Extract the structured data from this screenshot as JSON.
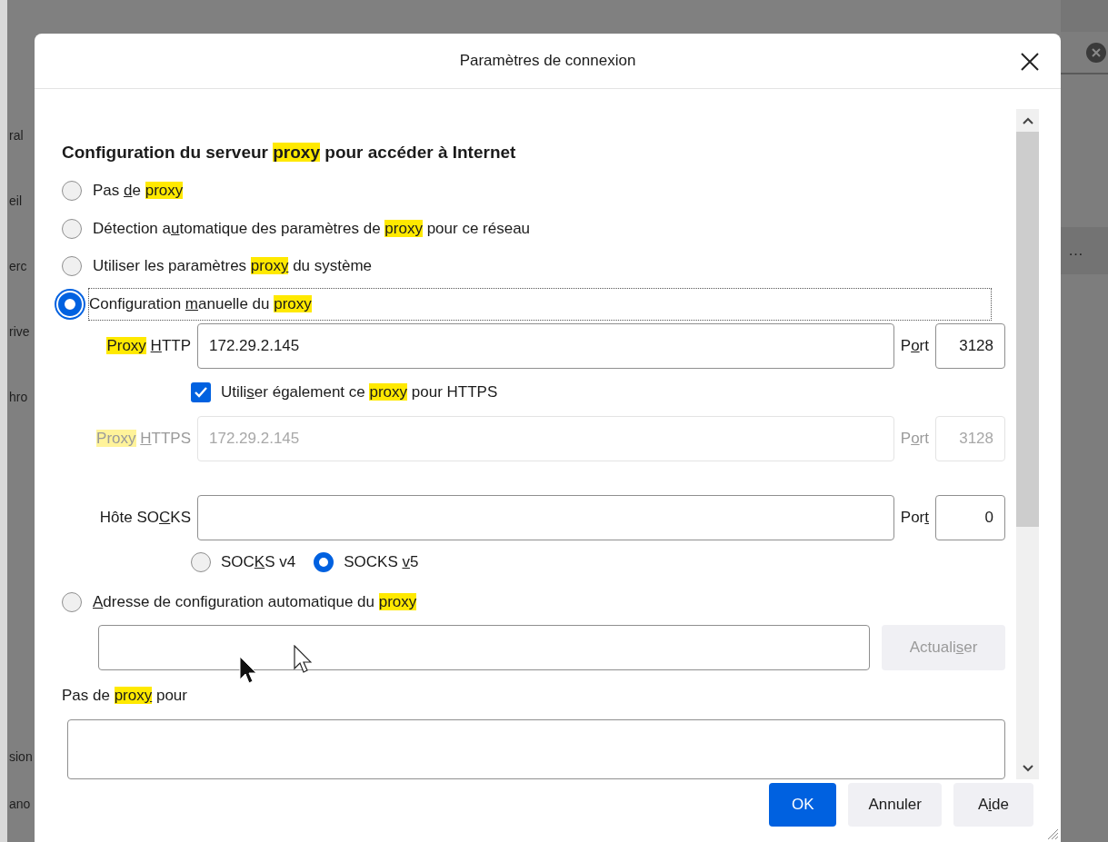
{
  "background": {
    "sidebar_items": [
      "ral",
      "eil",
      "erc",
      "rive",
      "hro",
      "sion",
      "ano"
    ],
    "menu_text": "…"
  },
  "dialog": {
    "title": "Paramètres de connexion",
    "heading": [
      {
        "text": "Configuration du serveur "
      },
      {
        "text": "proxy",
        "highlight": true
      },
      {
        "text": " pour accéder à Internet"
      }
    ],
    "modes": [
      {
        "label": [
          {
            "text": "Pas "
          },
          {
            "text": "d",
            "underline": true
          },
          {
            "text": "e "
          },
          {
            "text": "proxy",
            "highlight": true
          }
        ],
        "selected": false
      },
      {
        "label": [
          {
            "text": "Détection a"
          },
          {
            "text": "u",
            "underline": true
          },
          {
            "text": "tomatique des paramètres de "
          },
          {
            "text": "proxy",
            "highlight": true
          },
          {
            "text": " pour ce réseau"
          }
        ],
        "selected": false
      },
      {
        "label": [
          {
            "text": "Utiliser les paramètres "
          },
          {
            "text": "prox",
            "highlight": true
          },
          {
            "text": "y",
            "highlight": true,
            "underline": true
          },
          {
            "text": " du système"
          }
        ],
        "selected": false
      },
      {
        "label": [
          {
            "text": "Configuration "
          },
          {
            "text": "m",
            "underline": true
          },
          {
            "text": "anuelle du "
          },
          {
            "text": "proxy",
            "highlight": true
          }
        ],
        "selected": true,
        "focused": true,
        "items": [
          {
            "kind": "field",
            "label": [
              {
                "text": "Proxy",
                "highlight": true,
                "space_after": true
              },
              {
                "text": "H",
                "underline": true
              },
              {
                "text": "TTP"
              }
            ],
            "value": "172.29.2.145",
            "port_label": [
              {
                "text": "P"
              },
              {
                "text": "o",
                "underline": true
              },
              {
                "text": "rt"
              }
            ],
            "port": "3128",
            "disabled": false
          },
          {
            "kind": "checkbox",
            "label": [
              {
                "text": "Utili"
              },
              {
                "text": "s",
                "underline": true
              },
              {
                "text": "er également ce "
              },
              {
                "text": "proxy",
                "highlight": true
              },
              {
                "text": " pour HTTPS"
              }
            ],
            "checked": true
          },
          {
            "kind": "field",
            "label": [
              {
                "text": "Proxy",
                "highlight": true,
                "space_after": true
              },
              {
                "text": "H",
                "underline": true
              },
              {
                "text": "TTPS"
              }
            ],
            "value": "172.29.2.145",
            "port_label": [
              {
                "text": "P"
              },
              {
                "text": "o",
                "underline": true
              },
              {
                "text": "rt"
              }
            ],
            "port": "3128",
            "disabled": true
          },
          {
            "kind": "field",
            "label": [
              {
                "text": "Hôte SO"
              },
              {
                "text": "C",
                "underline": true
              },
              {
                "text": "KS"
              }
            ],
            "port_label": [
              {
                "text": "Por"
              },
              {
                "text": "t",
                "underline": true
              }
            ],
            "port": "0",
            "disabled": false
          },
          {
            "kind": "radios",
            "options": [
              {
                "label": [
                  {
                    "text": "SOC"
                  },
                  {
                    "text": "K",
                    "underline": true
                  },
                  {
                    "text": "S v4"
                  }
                ],
                "selected": false
              },
              {
                "label": [
                  {
                    "text": "SOCKS "
                  },
                  {
                    "text": "v",
                    "underline": true
                  },
                  {
                    "text": "5"
                  }
                ],
                "selected": true
              }
            ]
          }
        ]
      },
      {
        "label": [
          {
            "text": "A",
            "underline": true
          },
          {
            "text": "dresse de configuration automatique du "
          },
          {
            "text": "proxy",
            "highlight": true
          }
        ],
        "selected": false,
        "items": [
          {
            "kind": "url",
            "button": [
              {
                "text": "Actuali"
              },
              {
                "text": "s",
                "underline": true
              },
              {
                "text": "er"
              }
            ],
            "disabled": true
          }
        ]
      }
    ],
    "no_proxy": {
      "label": [
        {
          "text": "Pas de "
        },
        {
          "text": "prox",
          "highlight": true
        },
        {
          "text": "y",
          "highlight": true,
          "underline": true
        },
        {
          "text": " pour"
        }
      ]
    },
    "buttons": [
      {
        "label": [
          {
            "text": "OK"
          }
        ],
        "kind": "primary"
      },
      {
        "label": [
          {
            "text": "Annuler"
          }
        ],
        "kind": "secondary"
      },
      {
        "label": [
          {
            "text": "A"
          },
          {
            "text": "i",
            "underline": true
          },
          {
            "text": "de"
          }
        ],
        "kind": "secondary"
      }
    ]
  }
}
